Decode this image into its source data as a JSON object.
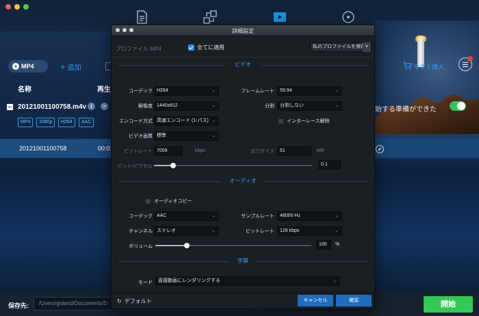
{
  "app": {
    "format": "MP4",
    "add_label": "追加",
    "buy_label": "今すぐ購入",
    "columns": {
      "name": "名称",
      "duration": "再生時"
    },
    "file": {
      "name": "20121001100758.m4v",
      "info_glyph": "i",
      "remove_glyph": "×",
      "tags": [
        "MP4",
        "1080p",
        "H264",
        "AAC"
      ]
    },
    "ready_text": "始する準備ができた",
    "clip": {
      "name": "20121001100758",
      "time": "00:01"
    },
    "save": {
      "label": "保存先:",
      "path": "/Users/goland/Documents/D",
      "browse_glyph": "…"
    },
    "start_label": "開始",
    "accent_color": "#2d9bf0",
    "start_color": "#34c957"
  },
  "modal": {
    "title": "詳細設定",
    "profile_label": "プロファイル MP4",
    "apply_all": {
      "label": "全てに適用",
      "checked": true
    },
    "save_profile": "私のプロファイルを保存",
    "video": {
      "heading": "ビデオ",
      "codec": {
        "label": "コーデック",
        "value": "H264"
      },
      "framerate": {
        "label": "フレームレート",
        "value": "59.94"
      },
      "resolution": {
        "label": "解像度",
        "value": "1440x812"
      },
      "split": {
        "label": "分割",
        "value": "分割しない"
      },
      "encode": {
        "label": "エンコード方式",
        "value": "高速エンコード (1-パス)"
      },
      "deinterlace": {
        "label": "インターレース解除",
        "checked": false
      },
      "quality": {
        "label": "ビデオ画質",
        "value": "標準"
      },
      "bitrate": {
        "label": "ビットレート",
        "value": "7009",
        "unit": "kbps"
      },
      "output_size": {
        "label": "出力サイズ",
        "value": "51",
        "unit": "MB"
      },
      "bits_per_pixel": {
        "label": "ビット/ピクセル",
        "value": "0.1"
      }
    },
    "audio": {
      "heading": "オーディオ",
      "copy": {
        "label": "オーディオコピー",
        "checked": false
      },
      "codec": {
        "label": "コーデック",
        "value": "AAC"
      },
      "samplerate": {
        "label": "サンプルレート",
        "value": "48000 Hz"
      },
      "channel": {
        "label": "チャンネル",
        "value": "ステレオ"
      },
      "bitrate": {
        "label": "ビットレート",
        "value": "128 kbps"
      },
      "volume": {
        "label": "ボリューム",
        "value": "100",
        "unit": "%"
      }
    },
    "subtitle": {
      "heading": "字幕",
      "mode": {
        "label": "モード",
        "value": "直接動画にレンダリングする"
      }
    },
    "footer": {
      "default_label": "デフォルト",
      "cancel_label": "キャンセル",
      "ok_label": "確認"
    }
  }
}
